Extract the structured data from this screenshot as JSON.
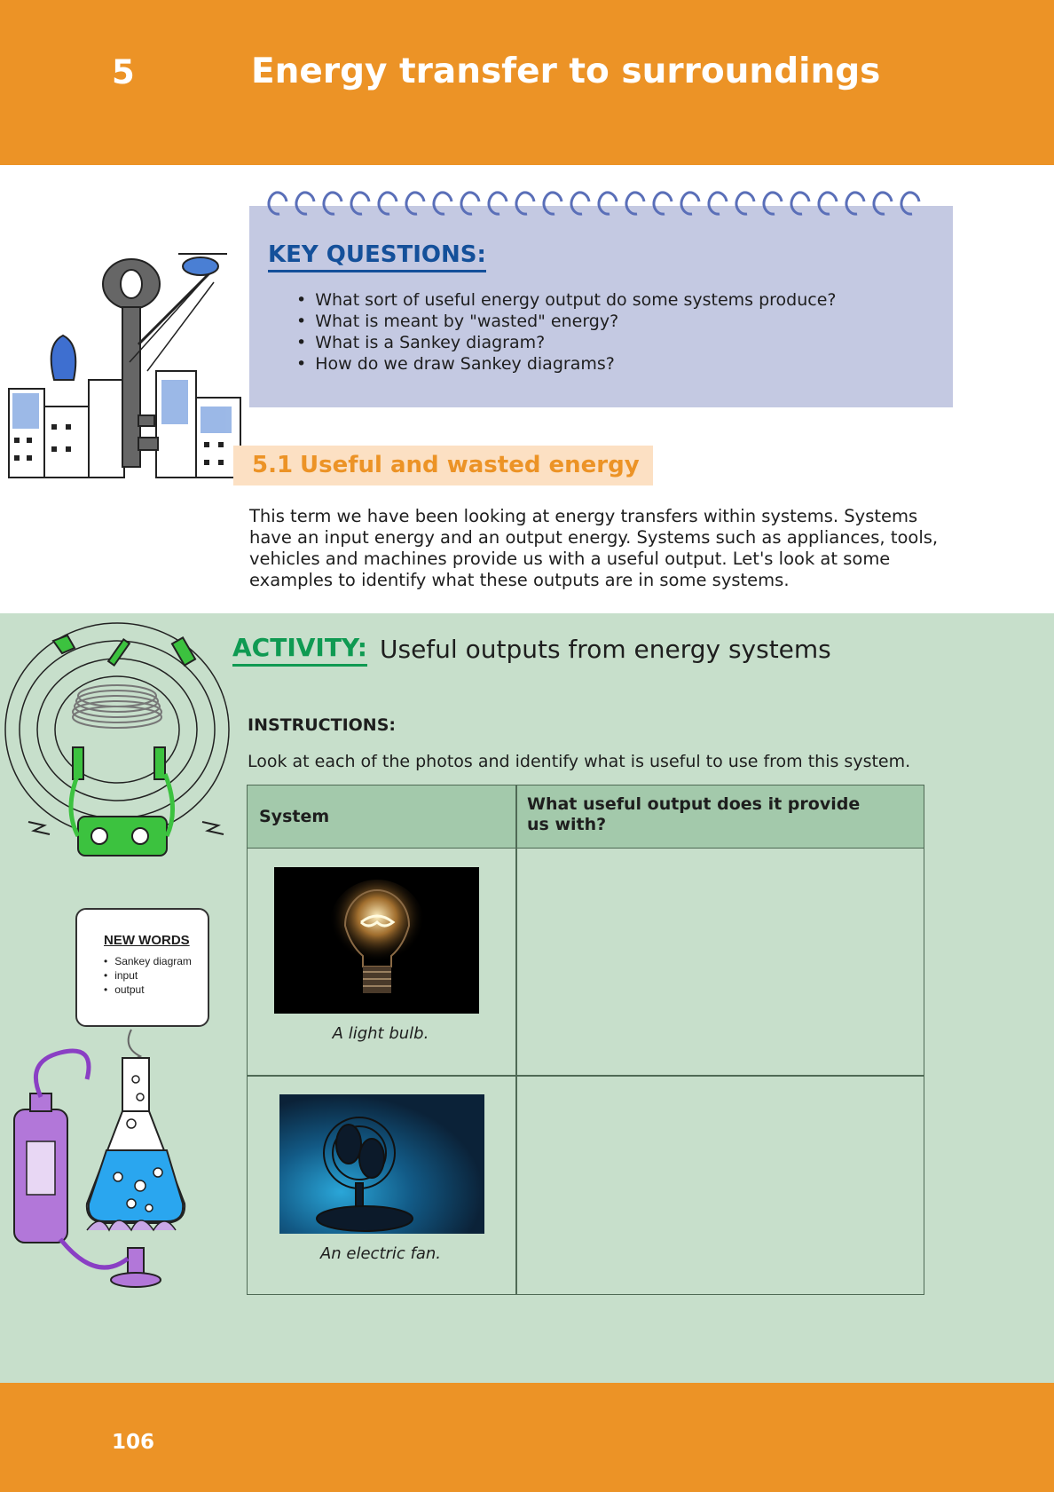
{
  "header": {
    "chapter_number": "5",
    "chapter_title": "Energy transfer to surroundings"
  },
  "key_questions": {
    "title": "KEY QUESTIONS:",
    "items": [
      "What sort of useful energy output do some systems produce?",
      "What is meant by \"wasted\" energy?",
      "What is a Sankey diagram?",
      "How do we draw Sankey diagrams?"
    ]
  },
  "section": {
    "number": "5.1",
    "title": "Useful and wasted energy",
    "intro": "This term we have been looking at energy transfers within systems. Systems have an input energy and an output energy. Systems such as appliances, tools, vehicles and machines provide us with a useful output. Let's look at some examples to identify what these outputs are in some systems."
  },
  "activity": {
    "label": "ACTIVITY:",
    "title": "Useful outputs from energy systems",
    "instructions_label": "INSTRUCTIONS:",
    "instructions_text": "Look at each of the photos and identify what is useful to use from this system.",
    "table": {
      "headers": [
        "System",
        "What useful output does it provide us with?"
      ],
      "rows": [
        {
          "caption": "A light bulb.",
          "answer": ""
        },
        {
          "caption": "An electric fan.",
          "answer": ""
        }
      ]
    }
  },
  "new_words": {
    "title": "NEW WORDS",
    "items": [
      "Sankey diagram",
      "input",
      "output"
    ]
  },
  "footer": {
    "page_number": "106"
  },
  "colors": {
    "orange": "#ec9326",
    "blue": "#14509a",
    "green": "#0f9a52",
    "notepad": "#c4c9e2",
    "activity_bg": "#c7dfcb",
    "table_header": "#a3c9ab"
  }
}
